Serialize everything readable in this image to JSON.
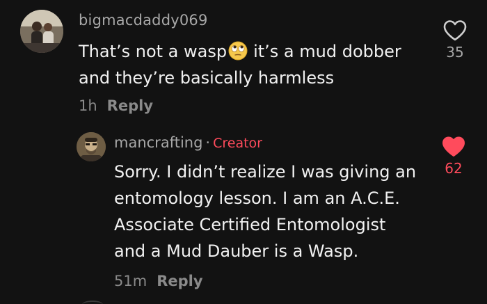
{
  "top_comment": {
    "username": "bigmacdaddy069",
    "text_before_emoji": "That’s not a wasp",
    "emoji": "face-with-rolling-eyes",
    "text_after_emoji": "it’s a mud dobber",
    "text_line2": "and they’re basically harmless",
    "time": "1h",
    "reply_label": "Reply",
    "like_count": "35",
    "liked": false
  },
  "reply_comment": {
    "username": "mancrafting",
    "separator": "·",
    "badge": "Creator",
    "lines": [
      "Sorry. I didn’t realize I was giving an",
      "entomology lesson. I am an A.C.E.",
      "Associate Certified Entomologist",
      "and a Mud Dauber is a Wasp."
    ],
    "time": "51m",
    "reply_label": "Reply",
    "like_count": "62",
    "liked": true
  },
  "colors": {
    "background": "#121212",
    "text": "#f1f1f1",
    "muted": "#a8a8a8",
    "accent_red": "#ff4b5c"
  }
}
